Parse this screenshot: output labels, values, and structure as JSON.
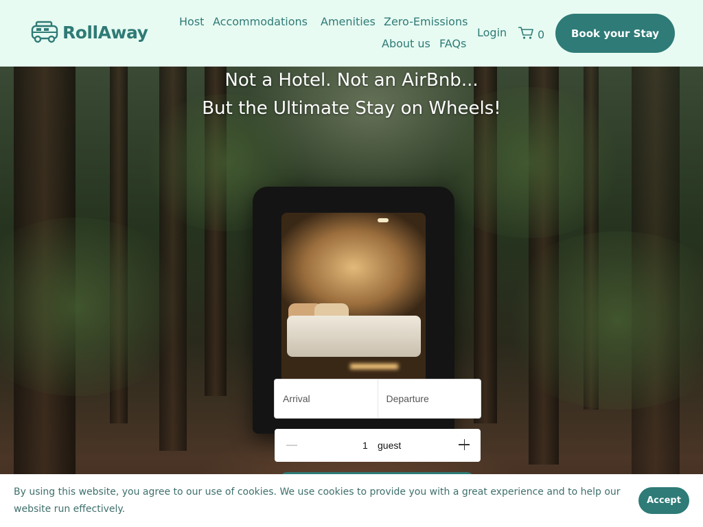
{
  "brand": {
    "name": "RollAway",
    "logo_icon": "van-icon",
    "accent": "#2e7b77",
    "header_bg": "#e7fbf2"
  },
  "nav": {
    "items": [
      {
        "label": "Host"
      },
      {
        "label": "Accommodations"
      },
      {
        "label": "Amenities"
      },
      {
        "label": "Zero-Emissions"
      },
      {
        "label": "About us"
      },
      {
        "label": "FAQs"
      }
    ],
    "login_label": "Login",
    "cart_count": "0",
    "book_label": "Book your Stay"
  },
  "hero": {
    "title_line1": "Not a Hotel. Not an AirBnb...",
    "title_line2": "But the Ultimate Stay on Wheels!"
  },
  "booking": {
    "arrival_label": "Arrival",
    "departure_label": "Departure",
    "guest_count": "1",
    "guest_label": "guest"
  },
  "cookie": {
    "text": "By using this website, you agree to our use of cookies. We use cookies to provide you with a great experience and to help our website run effectively.",
    "accept_label": "Accept"
  }
}
